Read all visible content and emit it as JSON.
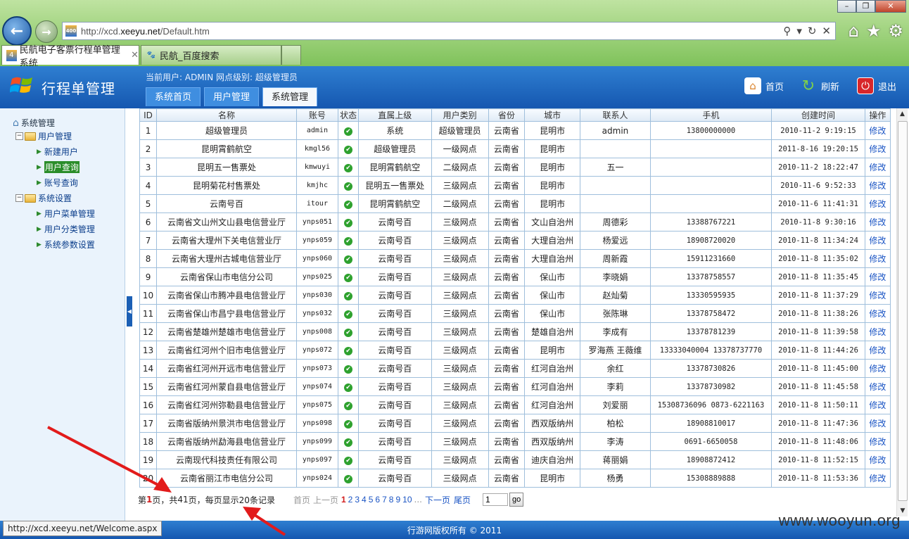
{
  "browser": {
    "url_prefix": "http://xcd.",
    "url_domain": "xeeyu.net",
    "url_suffix": "/Default.htm",
    "tabs": [
      {
        "label": "民航电子客票行程单管理系统"
      },
      {
        "label": "民航_百度搜索"
      }
    ],
    "status_url": "http://xcd.xeeyu.net/Welcome.aspx"
  },
  "header": {
    "title": "行程单管理",
    "current_user": "当前用户: ADMIN 网点级别: 超级管理员",
    "tabs": [
      {
        "label": "系统首页"
      },
      {
        "label": "用户管理"
      },
      {
        "label": "系统管理"
      }
    ],
    "actions": {
      "home": "首页",
      "refresh": "刷新",
      "logout": "退出"
    }
  },
  "sidebar": {
    "root": "系统管理",
    "group1": "用户管理",
    "item_new_user": "新建用户",
    "item_user_query": "用户查询",
    "item_account_query": "账号查询",
    "group2": "系统设置",
    "item_menu_mgmt": "用户菜单管理",
    "item_category_mgmt": "用户分类管理",
    "item_params": "系统参数设置"
  },
  "table": {
    "columns": [
      "ID",
      "名称",
      "账号",
      "状态",
      "直属上级",
      "用户类别",
      "省份",
      "城市",
      "联系人",
      "手机",
      "创建时间",
      "操作"
    ],
    "edit_label": "修改",
    "rows": [
      [
        "1",
        "超级管理员",
        "admin",
        "系统",
        "超级管理员",
        "云南省",
        "昆明市",
        "admin",
        "13800000000",
        "2010-11-2 9:19:15"
      ],
      [
        "2",
        "昆明霄鹤航空",
        "kmgl56",
        "超级管理员",
        "一级网点",
        "云南省",
        "昆明市",
        "",
        "",
        "2011-8-16 19:20:15"
      ],
      [
        "3",
        "昆明五一售票处",
        "kmwuyi",
        "昆明霄鹤航空",
        "二级网点",
        "云南省",
        "昆明市",
        "五一",
        "",
        "2010-11-2 18:22:47"
      ],
      [
        "4",
        "昆明菊花村售票处",
        "kmjhc",
        "昆明五一售票处",
        "三级网点",
        "云南省",
        "昆明市",
        "",
        "",
        "2010-11-6 9:52:33"
      ],
      [
        "5",
        "云南号百",
        "itour",
        "昆明霄鹤航空",
        "二级网点",
        "云南省",
        "昆明市",
        "",
        "",
        "2010-11-6 11:41:31"
      ],
      [
        "6",
        "云南省文山州文山县电信营业厅",
        "ynps051",
        "云南号百",
        "三级网点",
        "云南省",
        "文山自治州",
        "周德彩",
        "13388767221",
        "2010-11-8 9:30:16"
      ],
      [
        "7",
        "云南省大理州下关电信营业厅",
        "ynps059",
        "云南号百",
        "三级网点",
        "云南省",
        "大理自治州",
        "杨爱远",
        "18908720020",
        "2010-11-8 11:34:24"
      ],
      [
        "8",
        "云南省大理州古城电信营业厅",
        "ynps060",
        "云南号百",
        "三级网点",
        "云南省",
        "大理自治州",
        "周新霞",
        "15911231660",
        "2010-11-8 11:35:02"
      ],
      [
        "9",
        "云南省保山市电信分公司",
        "ynps025",
        "云南号百",
        "三级网点",
        "云南省",
        "保山市",
        "李晓娟",
        "13378758557",
        "2010-11-8 11:35:45"
      ],
      [
        "10",
        "云南省保山市腾冲县电信营业厅",
        "ynps030",
        "云南号百",
        "三级网点",
        "云南省",
        "保山市",
        "赵灿菊",
        "13330595935",
        "2010-11-8 11:37:29"
      ],
      [
        "11",
        "云南省保山市昌宁县电信营业厅",
        "ynps032",
        "云南号百",
        "三级网点",
        "云南省",
        "保山市",
        "张陈琳",
        "13378758472",
        "2010-11-8 11:38:26"
      ],
      [
        "12",
        "云南省楚雄州楚雄市电信营业厅",
        "ynps008",
        "云南号百",
        "三级网点",
        "云南省",
        "楚雄自治州",
        "李成有",
        "13378781239",
        "2010-11-8 11:39:58"
      ],
      [
        "13",
        "云南省红河州个旧市电信营业厅",
        "ynps072",
        "云南号百",
        "三级网点",
        "云南省",
        "昆明市",
        "罗海燕 王薇维",
        "13333040004 13378737770",
        "2010-11-8 11:44:26"
      ],
      [
        "14",
        "云南省红河州开远市电信营业厅",
        "ynps073",
        "云南号百",
        "三级网点",
        "云南省",
        "红河自治州",
        "余红",
        "13378730826",
        "2010-11-8 11:45:00"
      ],
      [
        "15",
        "云南省红河州蒙自县电信营业厅",
        "ynps074",
        "云南号百",
        "三级网点",
        "云南省",
        "红河自治州",
        "李莉",
        "13378730982",
        "2010-11-8 11:45:58"
      ],
      [
        "16",
        "云南省红河州弥勒县电信营业厅",
        "ynps075",
        "云南号百",
        "三级网点",
        "云南省",
        "红河自治州",
        "刘爱丽",
        "15308736096 0873-6221163",
        "2010-11-8 11:50:11"
      ],
      [
        "17",
        "云南省版纳州景洪市电信营业厅",
        "ynps098",
        "云南号百",
        "三级网点",
        "云南省",
        "西双版纳州",
        "柏松",
        "18908810017",
        "2010-11-8 11:47:36"
      ],
      [
        "18",
        "云南省版纳州勐海县电信营业厅",
        "ynps099",
        "云南号百",
        "三级网点",
        "云南省",
        "西双版纳州",
        "李涛",
        "0691-6650058",
        "2010-11-8 11:48:06"
      ],
      [
        "19",
        "云南现代科技责任有限公司",
        "ynps097",
        "云南号百",
        "三级网点",
        "云南省",
        "迪庆自治州",
        "蒋丽娟",
        "18908872412",
        "2010-11-8 11:52:15"
      ],
      [
        "20",
        "云南省丽江市电信分公司",
        "ynps024",
        "云南号百",
        "三级网点",
        "云南省",
        "昆明市",
        "杨勇",
        "15308889888",
        "2010-11-8 11:53:36"
      ]
    ]
  },
  "pager": {
    "prefix": "第",
    "current": "1",
    "middle": "页，共",
    "total_pages": "41",
    "suffix": "页，每页显示20条记录",
    "first": "首页",
    "prev": "上一页",
    "pages": [
      "1",
      "2",
      "3",
      "4",
      "5",
      "6",
      "7",
      "8",
      "9",
      "10"
    ],
    "ellipsis": "...",
    "next": "下一页",
    "last": "尾页",
    "input_value": "1",
    "go": "go"
  },
  "footer": {
    "copyright": "行游网版权所有 © 2011"
  },
  "watermark": "www.wooyun.org",
  "colors": {
    "header_blue": "#1f6cc4",
    "link_blue": "#1a54c4",
    "status_green": "#2ea12e",
    "selected_green": "#2a8d2a",
    "annotation_red": "#e21b1b"
  }
}
